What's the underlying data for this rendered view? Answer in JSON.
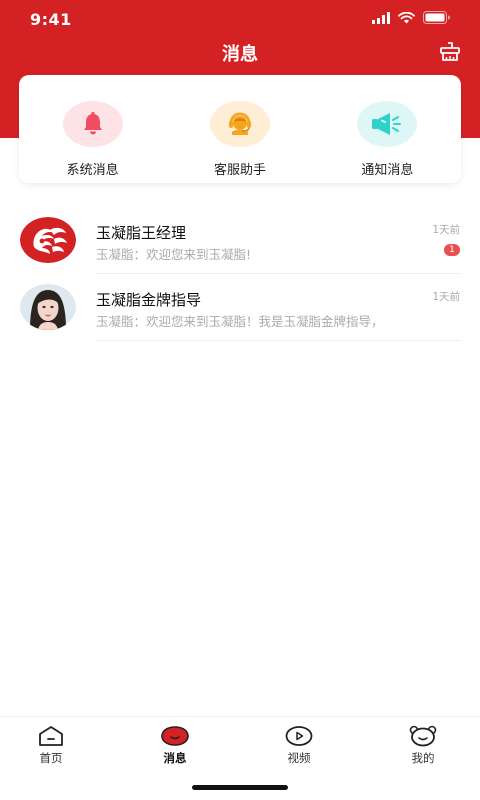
{
  "status_bar": {
    "time": "9:41"
  },
  "header": {
    "title": "消息"
  },
  "quick_actions": [
    {
      "label": "系统消息",
      "icon": "bell-icon",
      "bg": "#fde3e6",
      "color": "#f24c62"
    },
    {
      "label": "客服助手",
      "icon": "customer-service-icon",
      "bg": "#feeed6",
      "color": "#f7a51e"
    },
    {
      "label": "通知消息",
      "icon": "megaphone-icon",
      "bg": "#def7f6",
      "color": "#2fd1cc"
    }
  ],
  "messages": [
    {
      "name": "玉凝脂王经理",
      "preview": "玉凝脂：欢迎您来到玉凝脂!",
      "time": "1天前",
      "badge": "1",
      "avatar": "dragon-logo-avatar"
    },
    {
      "name": "玉凝脂金牌指导",
      "preview": "玉凝脂：欢迎您来到玉凝脂！我是玉凝脂金牌指导，",
      "time": "1天前",
      "badge": "",
      "avatar": "woman-portrait-avatar"
    }
  ],
  "tabbar": {
    "items": [
      {
        "label": "首页",
        "icon": "home-icon",
        "active": false
      },
      {
        "label": "消息",
        "icon": "message-icon",
        "active": true
      },
      {
        "label": "视频",
        "icon": "video-icon",
        "active": false
      },
      {
        "label": "我的",
        "icon": "profile-icon",
        "active": false
      }
    ]
  },
  "colors": {
    "brand_red": "#d42224",
    "badge_red": "#e65050"
  }
}
